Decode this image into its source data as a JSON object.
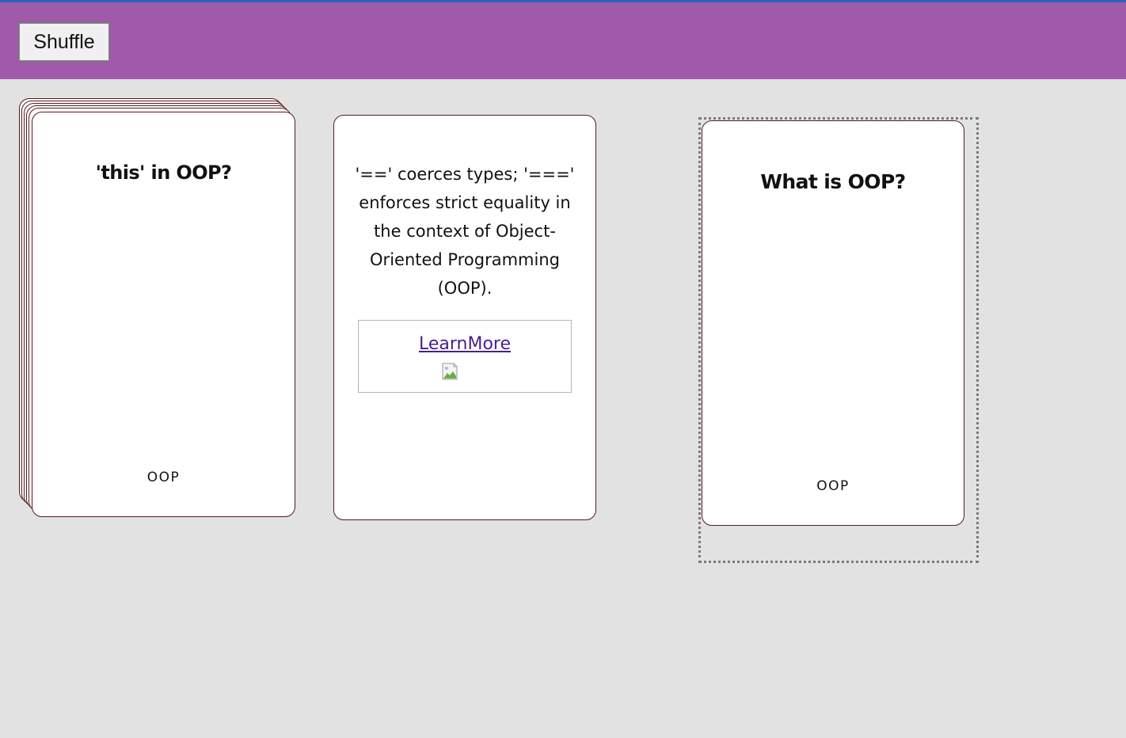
{
  "toolbar": {
    "shuffle_label": "Shuffle"
  },
  "deck": {
    "question": "'this' in OOP?",
    "category": "OOP"
  },
  "answer_card": {
    "text": "'==' coerces types; '===' enforces strict equality in the context of Object-Oriented Programming (OOP).",
    "link_label": "LearnMore"
  },
  "drop_card": {
    "question": "What is OOP?",
    "category": "OOP"
  },
  "colors": {
    "header": "#a05aaa",
    "background": "#e2e2e2",
    "card_border": "#5a1a1a",
    "link": "#4a1f86",
    "top_line": "#2a63b8"
  },
  "icons": {
    "broken_image": "broken-image-icon"
  }
}
